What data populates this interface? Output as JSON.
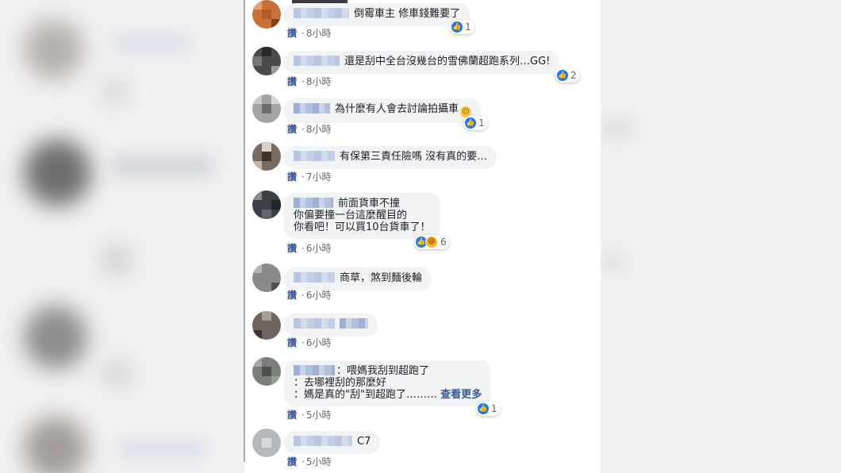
{
  "ui": {
    "like_label": "讚",
    "dot": "·",
    "see_more": "查看更多"
  },
  "comments": [
    {
      "text": "倒霉車主 修車錢難要了",
      "time": "8小時",
      "reactions": "1"
    },
    {
      "text": "還是刮中全台沒幾台的雪佛蘭超跑系列…GG!",
      "time": "8小時",
      "reactions": "2"
    },
    {
      "text": "為什麼有人會去討論拍攝車",
      "time": "8小時",
      "reactions": "1",
      "emoji": "sad-face-emoji"
    },
    {
      "text": "有保第三責任險嗎 沒有真的要…",
      "time": "7小時"
    },
    {
      "lines": [
        "前面貨車不撞",
        "你偏要撞一台這麼醒目的",
        "你看吧！可以買10台貨車了！"
      ],
      "time": "6小時",
      "reactions": "6"
    },
    {
      "text": "商草，煞到麵後輪",
      "time": "6小時"
    },
    {
      "text": "",
      "time": "6小時"
    },
    {
      "lines": [
        "：喂媽我刮到超跑了",
        "：去哪裡刮的那麼好",
        "：媽是真的\"刮\"到超跑了………"
      ],
      "time": "5小時",
      "reactions": "1"
    },
    {
      "text": "C7",
      "time": "5小時"
    }
  ],
  "colors": {
    "link": "#385898",
    "bubble": "#f2f3f5",
    "like_blue": "#1877f2",
    "haha_yellow": "#f7b125"
  }
}
